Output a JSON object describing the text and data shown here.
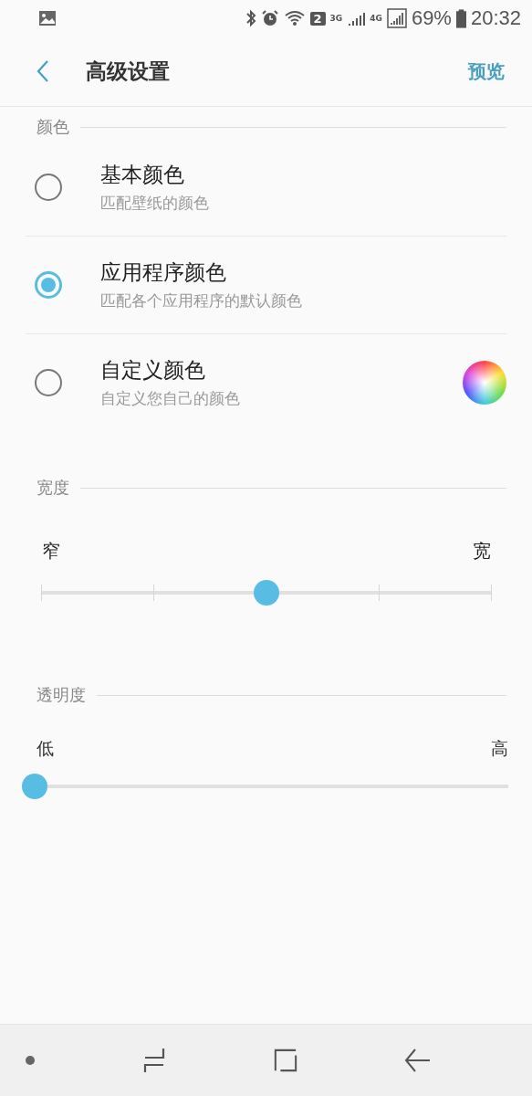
{
  "status_bar": {
    "sim_badge": "2",
    "network_1": "3G",
    "network_2": "4G",
    "battery": "69%",
    "time": "20:32"
  },
  "app_bar": {
    "title": "高级设置",
    "action": "预览"
  },
  "color_section": {
    "header": "颜色",
    "options": [
      {
        "kind": "plain",
        "title": "基本颜色",
        "subtitle": "匹配壁纸的颜色",
        "selected": false
      },
      {
        "kind": "plain",
        "title": "应用程序颜色",
        "subtitle": "匹配各个应用程序的默认颜色",
        "selected": true
      },
      {
        "kind": "picker",
        "title": "自定义颜色",
        "subtitle": "自定义您自己的颜色",
        "selected": false
      }
    ]
  },
  "width_section": {
    "header": "宽度",
    "min_label": "窄",
    "max_label": "宽",
    "level": 0.5
  },
  "transparency_section": {
    "header": "透明度",
    "min_label": "低",
    "max_label": "高",
    "level": 0
  }
}
